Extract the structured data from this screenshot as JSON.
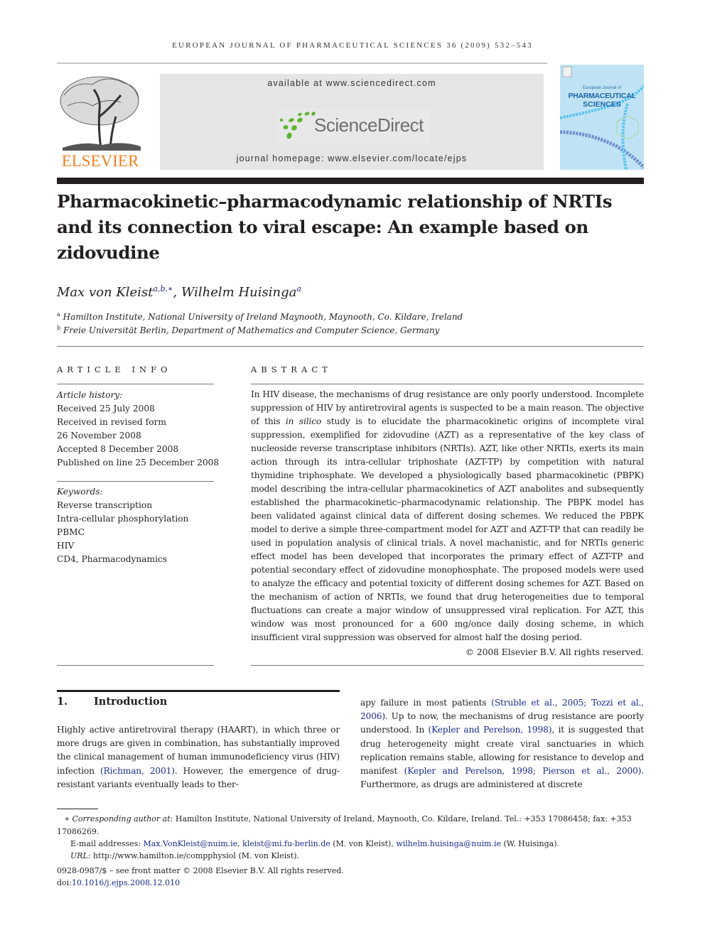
{
  "header": {
    "running_head": "EUROPEAN JOURNAL OF PHARMACEUTICAL SCIENCES 36 (2009) 532–543",
    "publisher_logo_text": "ELSEVIER",
    "available_at": "available at www.sciencedirect.com",
    "sciencedirect_logo_text": "ScienceDirect",
    "journal_homepage": "journal homepage: www.elsevier.com/locate/ejps",
    "cover": {
      "line1": "European Journal of",
      "line2": "PHARMACEUTICAL",
      "line3": "SCIENCES"
    }
  },
  "article": {
    "title": "Pharmacokinetic–pharmacodynamic relationship of NRTIs and its connection to viral escape: An example based on zidovudine",
    "authors": [
      {
        "name": "Max von Kleist",
        "sup": "a,b,∗"
      },
      {
        "name": "Wilhelm Huisinga",
        "sup": "a"
      }
    ],
    "affiliations": [
      {
        "mark": "a",
        "text": "Hamilton Institute, National University of Ireland Maynooth, Maynooth, Co. Kildare, Ireland"
      },
      {
        "mark": "b",
        "text": "Freie Universität Berlin, Department of Mathematics and Computer Science, Germany"
      }
    ]
  },
  "article_info": {
    "heading": "ARTICLE INFO",
    "history_label": "Article history:",
    "history": [
      "Received 25 July 2008",
      "Received in revised form",
      "26 November 2008",
      "Accepted 8 December 2008",
      "Published on line 25 December 2008"
    ],
    "keywords_label": "Keywords:",
    "keywords": [
      "Reverse transcription",
      "Intra-cellular phosphorylation",
      "PBMC",
      "HIV",
      "CD4, Pharmacodynamics"
    ]
  },
  "abstract": {
    "heading": "ABSTRACT",
    "part1": "In HIV disease, the mechanisms of drug resistance are only poorly understood. Incomplete suppression of HIV by antiretroviral agents is suspected to be a main reason. The objective of this ",
    "italic": "in silico",
    "part2": " study is to elucidate the pharmacokinetic origins of incomplete viral suppression, exemplified for zidovudine (AZT) as a representative of the key class of nucleoside reverse transcriptase inhibitors (NRTIs). AZT, like other NRTIs, exerts its main action through its intra-cellular triphoshate (AZT-TP) by competition with natural thymidine triphosphate. We developed a physiologically based pharmacokinetic (PBPK) model describing the intra-cellular pharmacokinetics of AZT anabolites and subsequently established the pharmacokinetic–pharmacodynamic relationship. The PBPK model has been validated against clinical data of different dosing schemes. We reduced the PBPK model to derive a simple three-compartment model for AZT and AZT-TP that can readily be used in population analysis of clinical trials. A novel machanistic, and for NRTIs generic effect model has been developed that incorporates the primary effect of AZT-TP and potential secondary effect of zidovudine monophosphate. The proposed models were used to analyze the efficacy and potential toxicity of different dosing schemes for AZT. Based on the mechanism of action of NRTIs, we found that drug heterogeneities due to temporal fluctuations can create a major window of unsuppressed viral replication. For AZT, this window was most pronounced for a 600 mg/once daily dosing scheme, in which insufficient viral suppression was observed for almost half the dosing period.",
    "copyright": "© 2008 Elsevier B.V. All rights reserved."
  },
  "introduction": {
    "number": "1.",
    "heading": "Introduction",
    "left": {
      "t1": "Highly active antiretroviral therapy (HAART), in which three or more drugs are given in combination, has substantially improved the clinical management of human immunodeficiency virus (HIV) infection ",
      "c1": "(Richman, 2001)",
      "t2": ". However, the emergence of drug-resistant variants eventually leads to ther-"
    },
    "right": {
      "t1": "apy failure in most patients ",
      "c1": "(Struble et al., 2005; Tozzi et al., 2006)",
      "t2": ". Up to now, the mechanisms of drug resistance are poorly understood. In ",
      "c2": "(Kepler and Perelson, 1998)",
      "t3": ", it is suggested that drug heterogeneity might create viral sanctuaries in which replication remains stable, allowing for resistance to develop and manifest ",
      "c3": "(Kepler and Perelson, 1998; Pierson et al., 2000)",
      "t4": ". Furthermore, as drugs are administered at discrete"
    }
  },
  "footnotes": {
    "star": "∗",
    "corr_label": "Corresponding author at",
    "corr_text": ": Hamilton Institute, National University of Ireland, Maynooth, Co. Kildare, Ireland. Tel.: +353 17086458; fax: +353 17086269.",
    "email_label": "E-mail addresses: ",
    "email1": "Max.VonKleist@nuim.ie",
    "sep1": ", ",
    "email2": "kleist@mi.fu-berlin.de",
    "after2": " (M. von Kleist), ",
    "email3": "wilhelm.huisinga@nuim.ie",
    "after3": " (W. Huisinga).",
    "url_label": "URL",
    "url_text": ": http://www.hamilton.ie/compphysiol (M. von Kleist).",
    "front_matter": "0928-0987/$ – see front matter © 2008 Elsevier B.V. All rights reserved.",
    "doi_label": "doi:",
    "doi": "10.1016/j.ejps.2008.12.010"
  }
}
